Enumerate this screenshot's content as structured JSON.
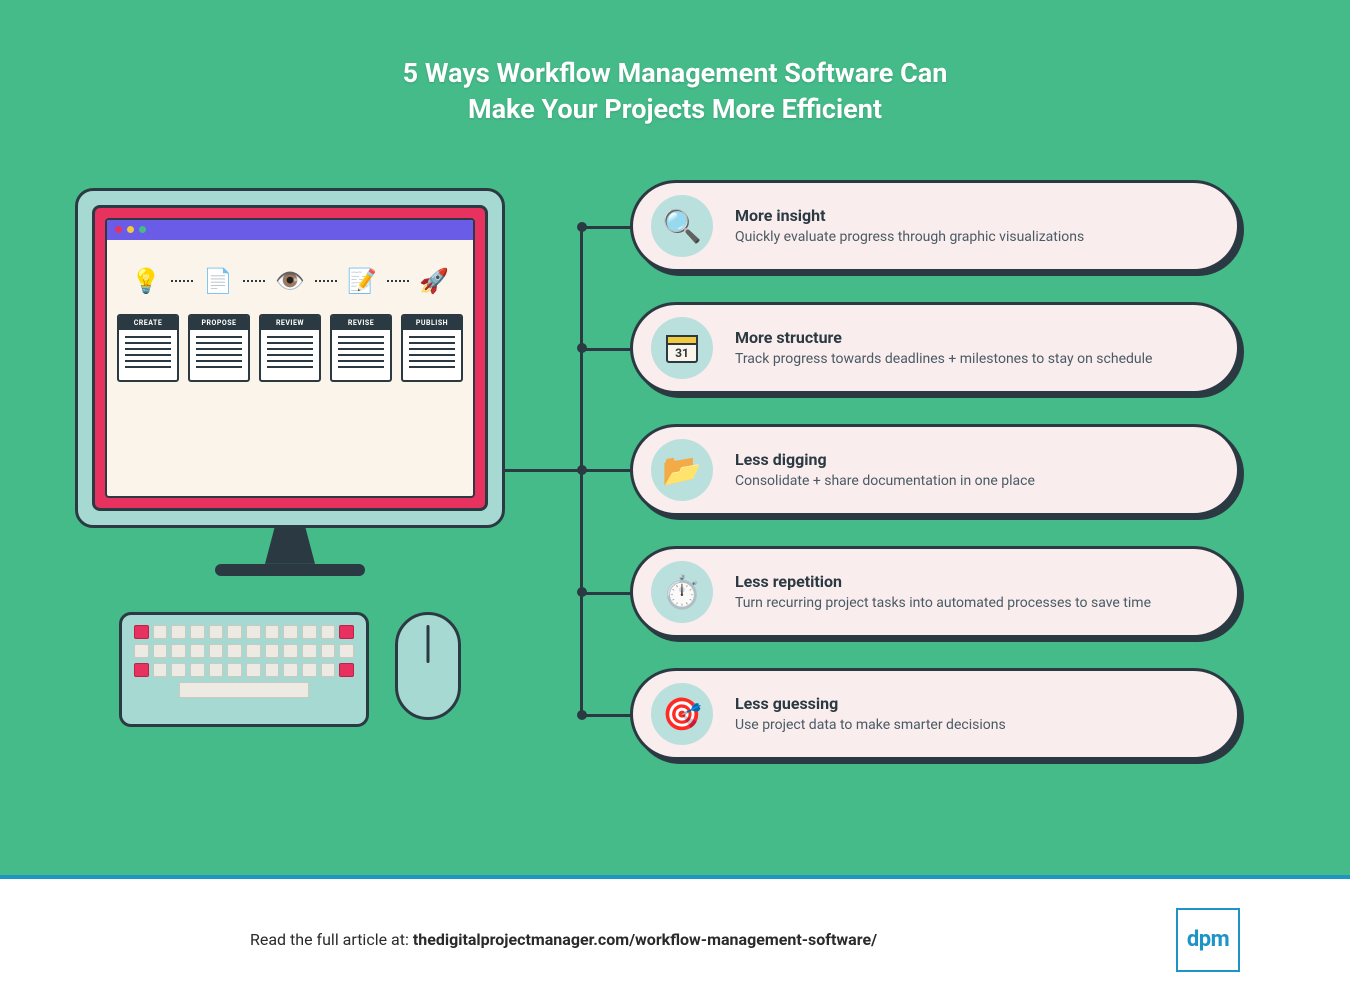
{
  "title_line1": "5 Ways Workflow Management Software Can",
  "title_line2": "Make Your Projects More Efficient",
  "workflow_steps": [
    {
      "label": "CREATE",
      "icon": "💡"
    },
    {
      "label": "PROPOSE",
      "icon": "📄"
    },
    {
      "label": "REVIEW",
      "icon": "👁️"
    },
    {
      "label": "REVISE",
      "icon": "📝"
    },
    {
      "label": "PUBLISH",
      "icon": "🚀"
    }
  ],
  "calendar_day": "31",
  "items": [
    {
      "heading": "More insight",
      "desc": "Quickly evaluate progress through graphic visualizations",
      "icon": "🔍"
    },
    {
      "heading": "More structure",
      "desc": "Track progress towards deadlines + milestones to stay on schedule",
      "icon": "📅"
    },
    {
      "heading": "Less digging",
      "desc": "Consolidate + share documentation in one place",
      "icon": "📂"
    },
    {
      "heading": "Less repetition",
      "desc": "Turn recurring project tasks into automated processes to save time",
      "icon": "⏱️"
    },
    {
      "heading": "Less guessing",
      "desc": "Use project data to make smarter decisions",
      "icon": "🎯"
    }
  ],
  "footer_prefix": "Read the full article at: ",
  "footer_link": "thedigitalprojectmanager.com/workflow-management-software/",
  "logo": "dpm"
}
